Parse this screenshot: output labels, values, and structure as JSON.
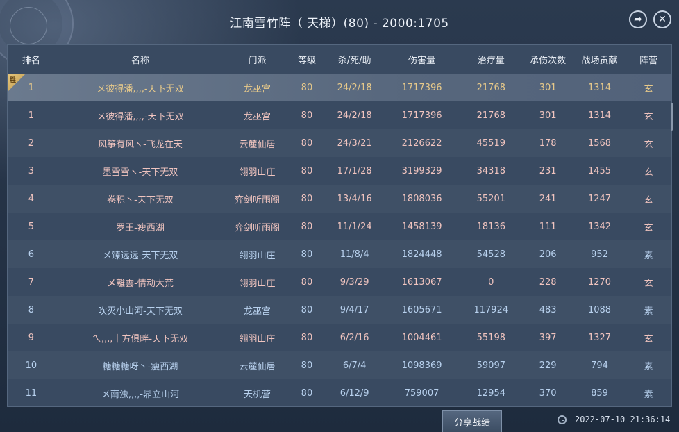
{
  "window": {
    "title": "江南雪竹阵（ 天梯）(80) - 2000:1705",
    "share_icon": "➦",
    "close_icon": "✕"
  },
  "table": {
    "headers": [
      "排名",
      "名称",
      "门派",
      "等级",
      "杀/死/助",
      "伤害量",
      "治疗量",
      "承伤次数",
      "战场贡献",
      "阵营"
    ],
    "self_badge": "胜",
    "rows": [
      [
        "1",
        "メ彼得潘,,,,-天下无双",
        "龙巫宫",
        "80",
        "24/2/18",
        "1717396",
        "21768",
        "301",
        "1314",
        "玄"
      ],
      [
        "1",
        "メ彼得潘,,,,-天下无双",
        "龙巫宫",
        "80",
        "24/2/18",
        "1717396",
        "21768",
        "301",
        "1314",
        "玄"
      ],
      [
        "2",
        "风筝有风ヽ-飞龙在天",
        "云麓仙居",
        "80",
        "24/3/21",
        "2126622",
        "45519",
        "178",
        "1568",
        "玄"
      ],
      [
        "3",
        "墨雪雪ヽ-天下无双",
        "翎羽山庄",
        "80",
        "17/1/28",
        "3199329",
        "34318",
        "231",
        "1455",
        "玄"
      ],
      [
        "4",
        "卷积丶-天下无双",
        "弈剑听雨阁",
        "80",
        "13/4/16",
        "1808036",
        "55201",
        "241",
        "1247",
        "玄"
      ],
      [
        "5",
        "罗王-瘦西湖",
        "弈剑听雨阁",
        "80",
        "11/1/24",
        "1458139",
        "18136",
        "111",
        "1342",
        "玄"
      ],
      [
        "6",
        "メ臻远远-天下无双",
        "翎羽山庄",
        "80",
        "11/8/4",
        "1824448",
        "54528",
        "206",
        "952",
        "素"
      ],
      [
        "7",
        "メ離雲-情动大荒",
        "翎羽山庄",
        "80",
        "9/3/29",
        "1613067",
        "0",
        "228",
        "1270",
        "玄"
      ],
      [
        "8",
        "吹灭小山河-天下无双",
        "龙巫宫",
        "80",
        "9/4/17",
        "1605671",
        "117924",
        "483",
        "1088",
        "素"
      ],
      [
        "9",
        "ㄟ,,,,十方俱畔-天下无双",
        "翎羽山庄",
        "80",
        "6/2/16",
        "1004461",
        "55198",
        "397",
        "1327",
        "玄"
      ],
      [
        "10",
        "糖糖糖呀丶-瘦西湖",
        "云麓仙居",
        "80",
        "6/7/4",
        "1098369",
        "59097",
        "229",
        "794",
        "素"
      ],
      [
        "11",
        "メ南浊,,,,-鼎立山河",
        "天机营",
        "80",
        "6/12/9",
        "759007",
        "12954",
        "370",
        "859",
        "素"
      ]
    ]
  },
  "footer": {
    "share_label": "分享战绩",
    "timestamp": "2022-07-10 21:36:14"
  }
}
